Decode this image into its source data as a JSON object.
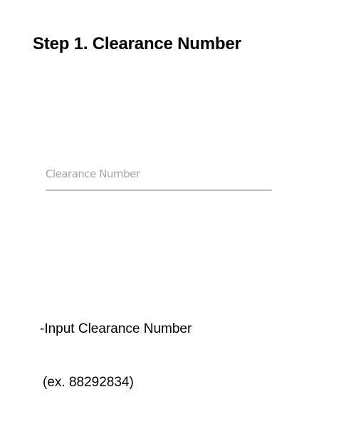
{
  "step": {
    "title": "Step 1. Clearance Number"
  },
  "clearance_field": {
    "placeholder": "Clearance Number",
    "value": ""
  },
  "instruction": {
    "line1": "-Input Clearance Number",
    "line2": "(ex. 88292834)"
  },
  "colors": {
    "background": "#ffffff",
    "text": "#000000",
    "placeholder": "#a6a6a6",
    "underline": "#bdbdbd"
  }
}
